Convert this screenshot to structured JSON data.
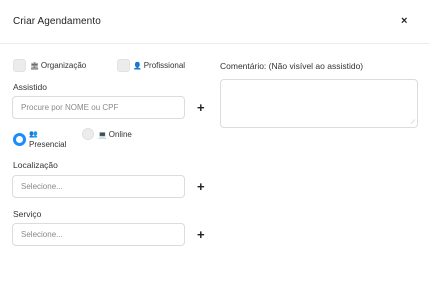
{
  "modal": {
    "title": "Criar Agendamento",
    "close_label": "×"
  },
  "filters": {
    "organizacao_label": "Organização",
    "profissional_label": "Profissional"
  },
  "assistido": {
    "label": "Assistido",
    "placeholder": "Procure por NOME ou CPF"
  },
  "modalidade": {
    "presencial_label": "Presencial",
    "online_label": "Online",
    "selected": "Presencial"
  },
  "localizacao": {
    "label": "Localização",
    "placeholder": "Selecione..."
  },
  "servico": {
    "label": "Serviço",
    "placeholder": "Selecione..."
  },
  "comentario": {
    "label": "Comentário: (Não visível ao assistido)",
    "value": ""
  },
  "add_label": "+",
  "icons": {
    "organizacao": "building-icon",
    "profissional": "user-icon",
    "presencial": "users-icon",
    "online": "laptop-icon"
  },
  "colors": {
    "accent": "#1a8cff"
  }
}
